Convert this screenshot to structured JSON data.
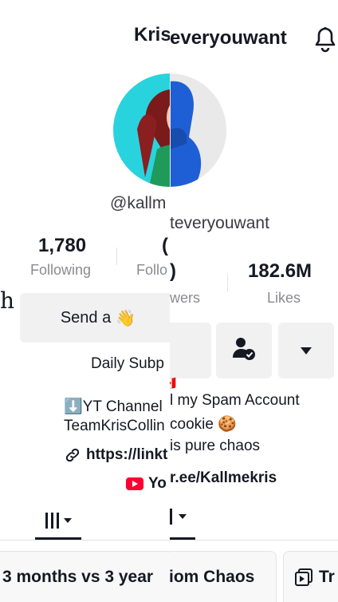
{
  "left": {
    "title": "Kris",
    "handle": "@kallm",
    "following_count": "1,780",
    "following_label": "Following",
    "followers_label": "Follo",
    "followers_partial_count": "(",
    "send_button_label": "Send a",
    "send_button_emoji": "👋",
    "bio": {
      "line1": "Daily Subp",
      "line2_emoji": "⬇️",
      "line2": "YT Channel",
      "line3": "TeamKrisCollin",
      "link": "https://linkt",
      "yt": "Yo"
    },
    "chip_label": "3 months vs 3 year",
    "stray_letter": "h"
  },
  "right": {
    "title": "everyouwant",
    "handle": "teveryouwant",
    "followers_paren": ")",
    "followers_label": "wers",
    "likes_count": "182.6M",
    "likes_label": "Likes",
    "flag": "🇨🇦",
    "bio": {
      "line1": "l my Spam Account",
      "line2": "cookie 🍪",
      "line3": "is pure chaos",
      "link": "r.ee/Kallmekris"
    },
    "chip1_label": "iom Chaos",
    "chip2_label": "Tr"
  },
  "colors": {
    "text": "#161823",
    "muted": "#8a8b91",
    "button_bg": "#f1f1f2",
    "avatar_left_bg": "#29d3de",
    "avatar_right_bg": "#e9e9e9",
    "hoodie_blue": "#1f5fd6",
    "youtube_red": "#ff0033"
  }
}
